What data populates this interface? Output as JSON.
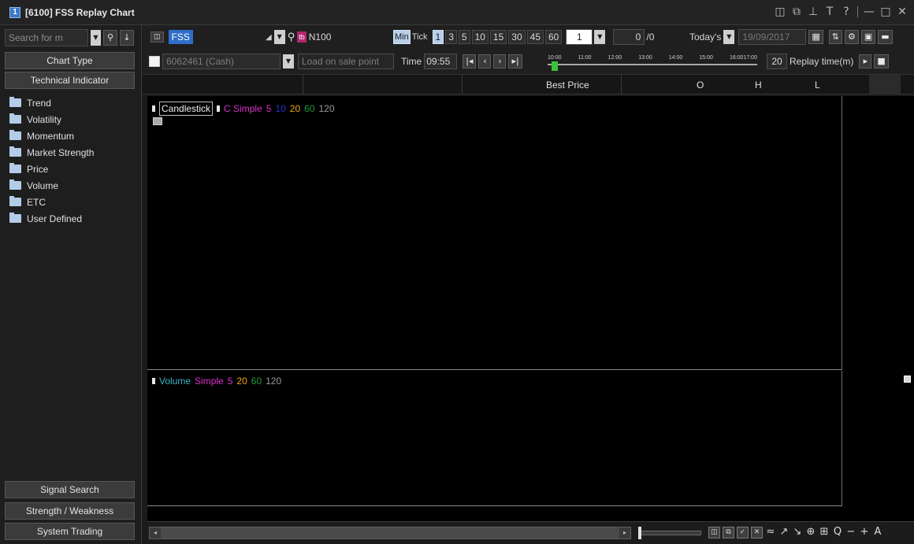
{
  "window": {
    "app_icon": "1",
    "title": "[6100] FSS Replay Chart"
  },
  "window_controls": [
    "◫",
    "⧉",
    "⊥",
    "T",
    "?",
    "—",
    "□",
    "✕"
  ],
  "sidebar": {
    "search_placeholder": "Search for m",
    "chart_type_label": "Chart Type",
    "technical_indicator_label": "Technical Indicator",
    "tree": [
      "Trend",
      "Volatility",
      "Momentum",
      "Market Strength",
      "Price",
      "Volume",
      "ETC",
      "User Defined"
    ],
    "signal_search_label": "Signal Search",
    "strength_weakness_label": "Strength / Weakness",
    "system_trading_label": "System Trading"
  },
  "toolbar1": {
    "symbol_name": "FSS",
    "item_code": "N100",
    "min_label": "Min",
    "tick_label": "Tick",
    "intervals": [
      "1",
      "3",
      "5",
      "10",
      "15",
      "30",
      "45",
      "60"
    ],
    "active_interval": "1",
    "interval_input": "1",
    "count_value": "0",
    "count_total": "/0",
    "date_mode": "Today's",
    "date_value": "19/09/2017",
    "icons": [
      "calendar-icon",
      "chart-settings-icon",
      "gear-icon",
      "save-icon",
      "folder-icon"
    ]
  },
  "toolbar2": {
    "account": "6062461 (Cash)",
    "load_button": "Load on sale point",
    "time_label": "Time",
    "time_value": "09:55",
    "timeline_labels": [
      "10:00",
      "11:00",
      "12:00",
      "13:00",
      "14:00",
      "15:00",
      "16:0017:00"
    ],
    "timeline_progress": 0.02,
    "replay_value": "20",
    "replay_label": "Replay time(m)"
  },
  "header_row": {
    "best_price": "Best Price",
    "open": "O",
    "high": "H",
    "low": "L"
  },
  "price_legend": {
    "candlestick": "Candlestick",
    "ma_prefix": "C Simple",
    "periods": [
      "5",
      "10",
      "20",
      "60",
      "120"
    ]
  },
  "volume_legend": {
    "volume": "Volume",
    "ma_prefix": "Simple",
    "periods": [
      "5",
      "20",
      "60",
      "120"
    ]
  },
  "colors": {
    "ma5": "#d633c8",
    "ma10": "#2433c9",
    "ma20": "#f0a21a",
    "ma60": "#1e9c3a",
    "ma120": "#9a9a9a",
    "volume": "#39b7c9",
    "symbol_bg": "#2f6ec8",
    "timeline_thumb": "#38c638"
  },
  "bottom_tools": [
    "◫",
    "⧉",
    "✓",
    "✕",
    "≈",
    "↗",
    "↘",
    "⊕",
    "⊞",
    "Q",
    "−",
    "+",
    "A"
  ]
}
